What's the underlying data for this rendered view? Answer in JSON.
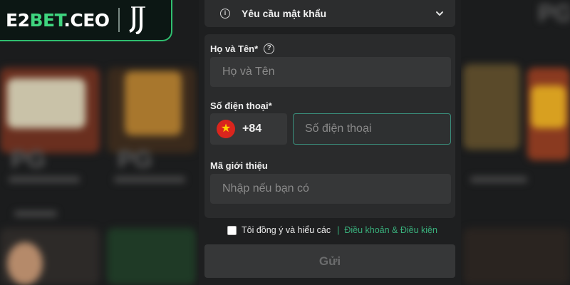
{
  "brand": {
    "name_white": "E2",
    "name_green": "BET",
    "name_suffix": ".CEO",
    "emblem_icon": "juventus-emblem-icon",
    "accent_color": "#3fd57f"
  },
  "form": {
    "password_request": {
      "label": "Yêu cầu mật khẩu",
      "icon": "info-icon"
    },
    "full_name": {
      "label": "Họ và Tên*",
      "placeholder": "Họ và Tên",
      "value": ""
    },
    "phone": {
      "label": "Số điện thoại*",
      "country_flag": "vietnam-flag-icon",
      "dial_code": "+84",
      "placeholder": "Số điện thoại",
      "value": ""
    },
    "referral": {
      "label": "Mã giới thiệu",
      "placeholder": "Nhập nếu bạn có",
      "value": ""
    },
    "agreement": {
      "text": "Tôi đồng ý và hiểu các",
      "separator": "|",
      "link": "Điều khoản & Điều kiện",
      "checked": false
    },
    "submit_label": "Gửi"
  }
}
